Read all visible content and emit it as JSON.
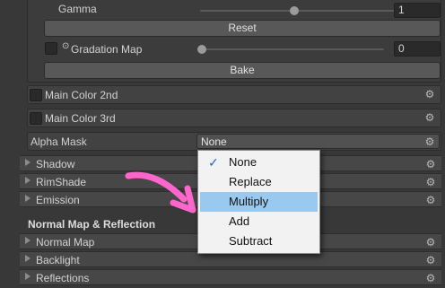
{
  "gradation": {
    "gamma_label": "Gamma",
    "gamma_value": "1",
    "gamma_level": 0.48,
    "reset_label": "Reset",
    "map_label": "Gradation Map",
    "map_value": "0",
    "map_level": 0.0,
    "bake_label": "Bake"
  },
  "properties": {
    "main_color_2nd": "Main Color 2nd",
    "main_color_3rd": "Main Color 3rd",
    "alpha_mask_label": "Alpha Mask",
    "alpha_mask_value": "None"
  },
  "foldouts": [
    "Shadow",
    "RimShade",
    "Emission"
  ],
  "section2": {
    "title": "Normal Map & Reflection",
    "foldouts": [
      "Normal Map",
      "Backlight",
      "Reflections"
    ]
  },
  "dropdown_menu": {
    "items": [
      "None",
      "Replace",
      "Multiply",
      "Add",
      "Subtract"
    ],
    "checked": "None",
    "highlighted": "Multiply"
  },
  "annotation": {
    "arrow_color": "#ff66cc"
  },
  "colors": {
    "background": "#383838",
    "highlight": "#99c9ef",
    "check": "#2166c7"
  },
  "icons": {
    "gear": "gear-icon",
    "foldout": "triangle-right-icon",
    "check": "checkmark-icon"
  }
}
